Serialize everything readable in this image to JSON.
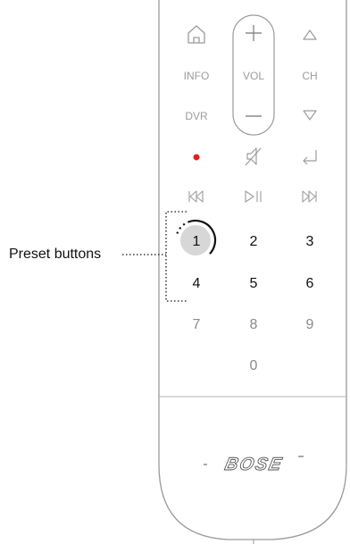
{
  "callout": {
    "label": "Preset buttons"
  },
  "buttons": {
    "info": "INFO",
    "vol": "VOL",
    "ch": "CH",
    "dvr": "DVR",
    "presets": [
      "1",
      "2",
      "3",
      "4",
      "5",
      "6"
    ],
    "digits": [
      "7",
      "8",
      "9",
      "0"
    ]
  },
  "brand": {
    "logo": "BOSE"
  },
  "colors": {
    "outline": "#9a9a9a",
    "icon": "#9c9c9c",
    "preset_text": "#111111",
    "digit_text": "#8a8a8a",
    "record": "#e02020",
    "highlight": "#d7d7d7"
  },
  "icons": [
    "home-icon",
    "plus-icon",
    "up-triangle-icon",
    "minus-icon",
    "down-triangle-icon",
    "record-icon",
    "mute-icon",
    "return-icon",
    "skip-back-icon",
    "play-pause-icon",
    "skip-forward-icon"
  ]
}
